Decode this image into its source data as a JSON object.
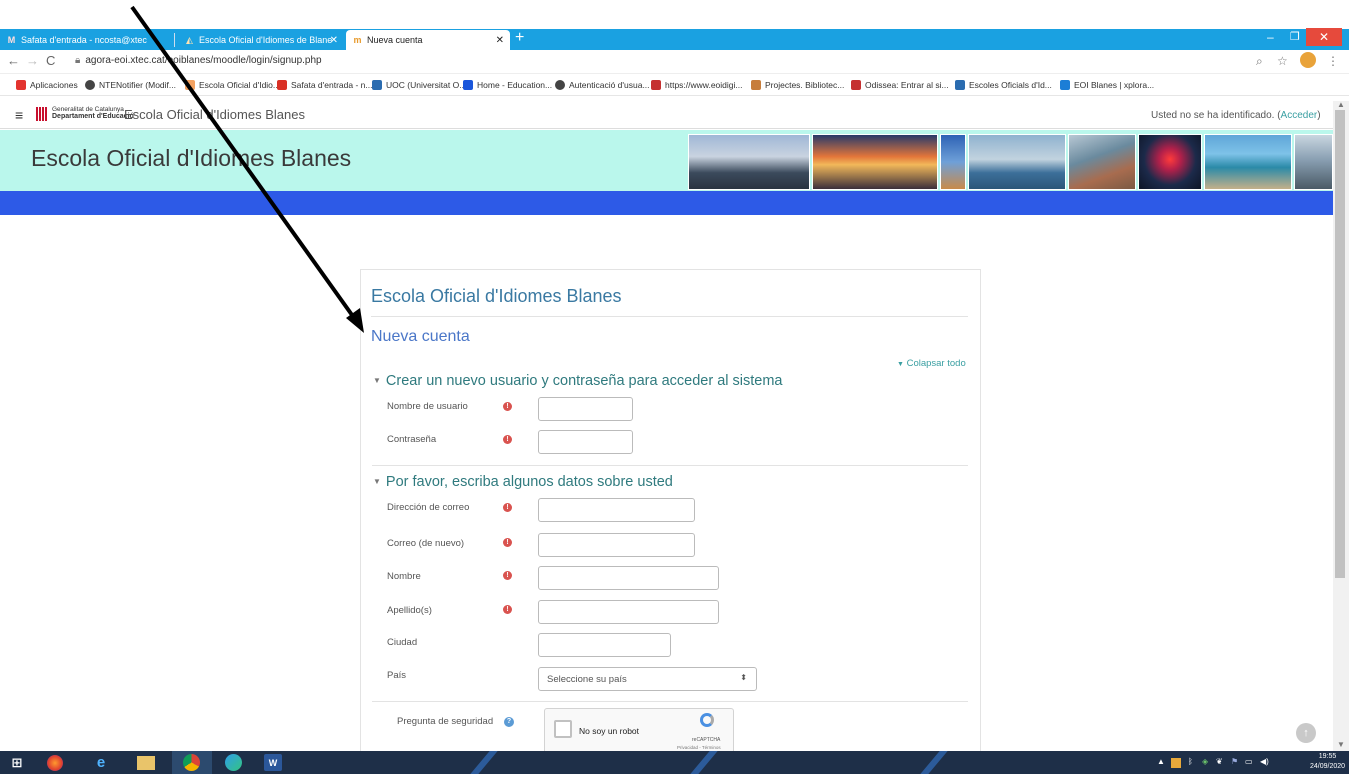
{
  "browser": {
    "tabs": [
      {
        "label": "Safata d'entrada - ncosta@xtec",
        "icon": "gmail-icon"
      },
      {
        "label": "Escola Oficial d'Idiomes de Blane",
        "icon": "moodle-icon"
      },
      {
        "label": "Nueva cuenta",
        "icon": "moodle-icon"
      }
    ],
    "new_tab": "+",
    "url": "agora-eoi.xtec.cat/eoiblanes/moodle/login/signup.php",
    "bookmarks": [
      {
        "label": "Aplicaciones",
        "color": "#e3342f"
      },
      {
        "label": "NTENotifier (Modif...",
        "color": "#444444"
      },
      {
        "label": "Escola Oficial d'Idio...",
        "color": "#f4a261"
      },
      {
        "label": "Safata d'entrada - n...",
        "color": "#d93025"
      },
      {
        "label": "UOC (Universitat O...",
        "color": "#2b6cb0"
      },
      {
        "label": "Home - Education...",
        "color": "#1a56db"
      },
      {
        "label": "Autenticació d'usua...",
        "color": "#444444"
      },
      {
        "label": "https://www.eoidigi...",
        "color": "#c53030"
      },
      {
        "label": "Projectes. Bibliotec...",
        "color": "#c77d3b"
      },
      {
        "label": "Odissea: Entrar al si...",
        "color": "#c53030"
      },
      {
        "label": "Escoles Oficials d'Id...",
        "color": "#2b6cb0"
      },
      {
        "label": "EOI Blanes | xplora...",
        "color": "#1c7ed6"
      }
    ]
  },
  "navbar": {
    "gencat_line1": "Generalitat de Catalunya",
    "gencat_line2": "Departament d'Educació",
    "site_short": "Escola Oficial d'Idiomes Blanes",
    "login_text": "Usted no se ha identificado. (",
    "login_link": "Acceder",
    "login_close": ")"
  },
  "header": {
    "title": "Escola Oficial d'Idiomes Blanes"
  },
  "signup": {
    "site_name": "Escola Oficial d'Idiomes Blanes",
    "heading": "Nueva cuenta",
    "collapse_all": "Colapsar todo",
    "section1": "Crear un nuevo usuario y contraseña para acceder al sistema",
    "section2": "Por favor, escriba algunos datos sobre usted",
    "fields": {
      "username": "Nombre de usuario",
      "password": "Contraseña",
      "email": "Dirección de correo",
      "email2": "Correo (de nuevo)",
      "firstname": "Nombre",
      "lastname": "Apellido(s)",
      "city": "Ciudad",
      "country": "País"
    },
    "country_placeholder": "Seleccione su país",
    "captcha_label": "Pregunta de seguridad",
    "captcha_text": "No soy un robot",
    "captcha_brand": "reCAPTCHA",
    "captcha_terms": "Privacidad - Términos"
  },
  "taskbar": {
    "time": "19:55",
    "date": "24/09/2020"
  },
  "colors": {
    "banner": "#baf7ec",
    "band": "#2d5ae7",
    "tabstrip": "#1aa1e1",
    "link": "#3a9fa2"
  }
}
